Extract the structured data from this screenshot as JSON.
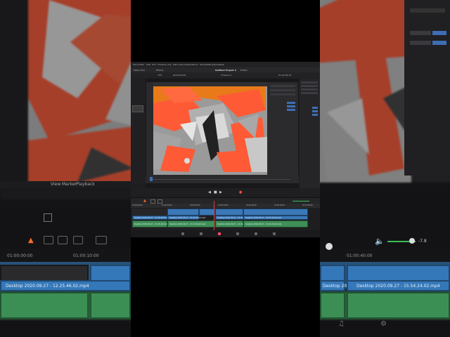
{
  "app": {
    "menu": [
      "Davinci",
      "Resolve",
      "File",
      "Edit",
      "Trim",
      "Timeline",
      "Clip",
      "Mark",
      "View",
      "Playback",
      "Fusion",
      "Color",
      "Fairlight",
      "Workspace",
      "Help"
    ],
    "project_title": "Untitled Project 2",
    "project_status": "Edited",
    "media_pool_label": "Media Pool",
    "effects_label": "Effects",
    "zoom_level": "75%",
    "timecode_left": "00:00:00:00",
    "timeline_name": "Timeline 1",
    "timecode_right": "01:00:04:13",
    "blender_header": [
      "View",
      "Marker",
      "Playback"
    ],
    "volume_value": "-7.8"
  },
  "colors": {
    "accent_orange": "#ff5a36",
    "video_clip": "#3a78b8",
    "audio_clip": "#3f8f58",
    "playhead": "#e03c3c"
  },
  "timeline": {
    "ruler_ticks": [
      "01:00:00:00",
      "01:00:10:00",
      "01:00:20:00",
      "01:00:30:00",
      "01:00:40:00",
      "01:00:50:00",
      "01:01:00:00"
    ],
    "video_clips": [
      "Desktop 2020.09.27 - 12.25.46.02.mp4",
      "Desktop 2020.09.27 - 13.12.34.02.mp4",
      "Desktop 2020.09.27 - 13.36.42.02.mp4",
      "Desktop 2020.09.27 - 15.54.24.02.mp4"
    ],
    "audio_clips": [
      "Desktop 2020.09.27 - 12.25.46.02.mp4",
      "Desktop 2020.09.27 - 13.12.34.02.mp4",
      "Desktop 2020.09.27 - 13.36.42.02.mp4",
      "Desktop 2020.09.27 - 15.54.24.02.mp4"
    ],
    "bg_ruler_left": "01:00:00:00",
    "bg_ruler_left2": "01:00:10:00",
    "bg_ruler_right": "01:00:40:00",
    "bg_clip_left": "Desktop 2020.09.27 - 12.25.46.02.mp4",
    "bg_clip_right_a": "Desktop 2020.09.27 - 13.36.42.02.mp4",
    "bg_clip_right_b": "Desktop 2020.09.27 - 15.54.24.02.mp4"
  },
  "icons": {
    "pointer": "pointer-icon",
    "blade": "blade-icon",
    "music": "music-icon",
    "speaker": "speaker-icon",
    "gear": "gear-icon"
  }
}
